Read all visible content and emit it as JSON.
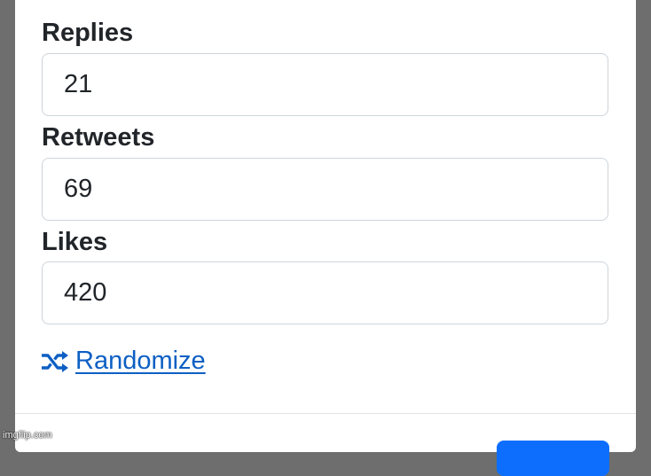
{
  "form": {
    "replies": {
      "label": "Replies",
      "value": "21"
    },
    "retweets": {
      "label": "Retweets",
      "value": "69"
    },
    "likes": {
      "label": "Likes",
      "value": "420"
    },
    "randomize": {
      "label": " Randomize",
      "icon": "shuffle-icon"
    }
  },
  "watermark": "imgflip.com",
  "colors": {
    "link": "#0d5fc4",
    "primary_button": "#0d6efd",
    "overlay": "#6e6e6e"
  }
}
